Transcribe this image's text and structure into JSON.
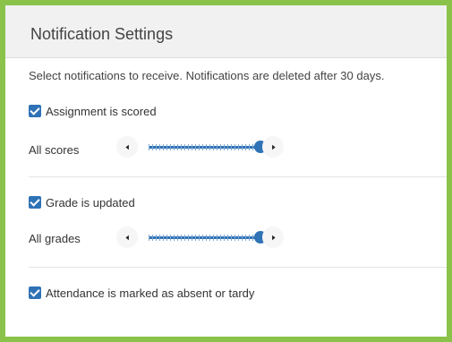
{
  "header": {
    "title": "Notification Settings"
  },
  "intro": "Select notifications to receive. Notifications are deleted after 30 days.",
  "sections": [
    {
      "checkbox_label": "Assignment is scored",
      "checked": true,
      "slider_label": "All scores",
      "slider_level": 1.0
    },
    {
      "checkbox_label": "Grade is updated",
      "checked": true,
      "slider_label": "All grades",
      "slider_level": 1.0
    },
    {
      "checkbox_label": "Attendance is marked as absent or tardy",
      "checked": true
    }
  ],
  "colors": {
    "accent": "#2f72b6",
    "frame": "#8bc34a",
    "header_bg": "#f1f1f1"
  },
  "icons": {
    "left_arrow": "caret-left-icon",
    "right_arrow": "caret-right-icon",
    "check": "checkmark-icon"
  }
}
